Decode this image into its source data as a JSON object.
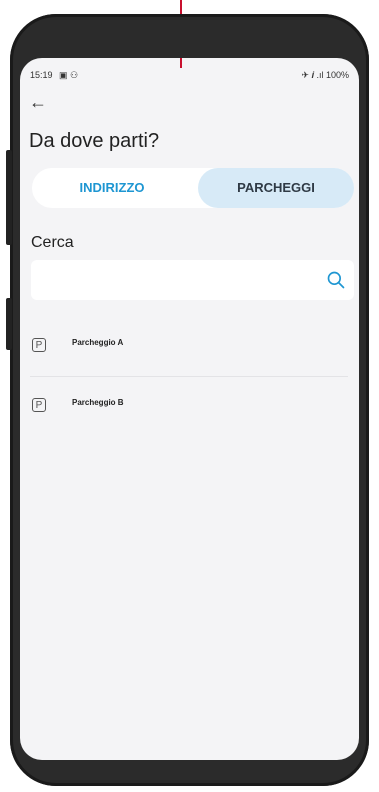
{
  "status_bar": {
    "time": "15:19",
    "left_icons": "▣ ⚇",
    "right_text": "✈ 𝒊 .ıl 100%"
  },
  "header": {
    "title": "Da dove parti?"
  },
  "tabs": [
    {
      "label": "INDIRIZZO",
      "selected": false
    },
    {
      "label": "PARCHEGGI",
      "selected": true
    }
  ],
  "search": {
    "label": "Cerca",
    "value": "",
    "placeholder": ""
  },
  "parking_list": [
    {
      "icon": "P",
      "name": "Parcheggio A"
    },
    {
      "icon": "P",
      "name": "Parcheggio B"
    }
  ],
  "colors": {
    "accent": "#1e96d2",
    "selected_tab_bg": "#d7eaf7",
    "background": "#f4f4f6"
  }
}
